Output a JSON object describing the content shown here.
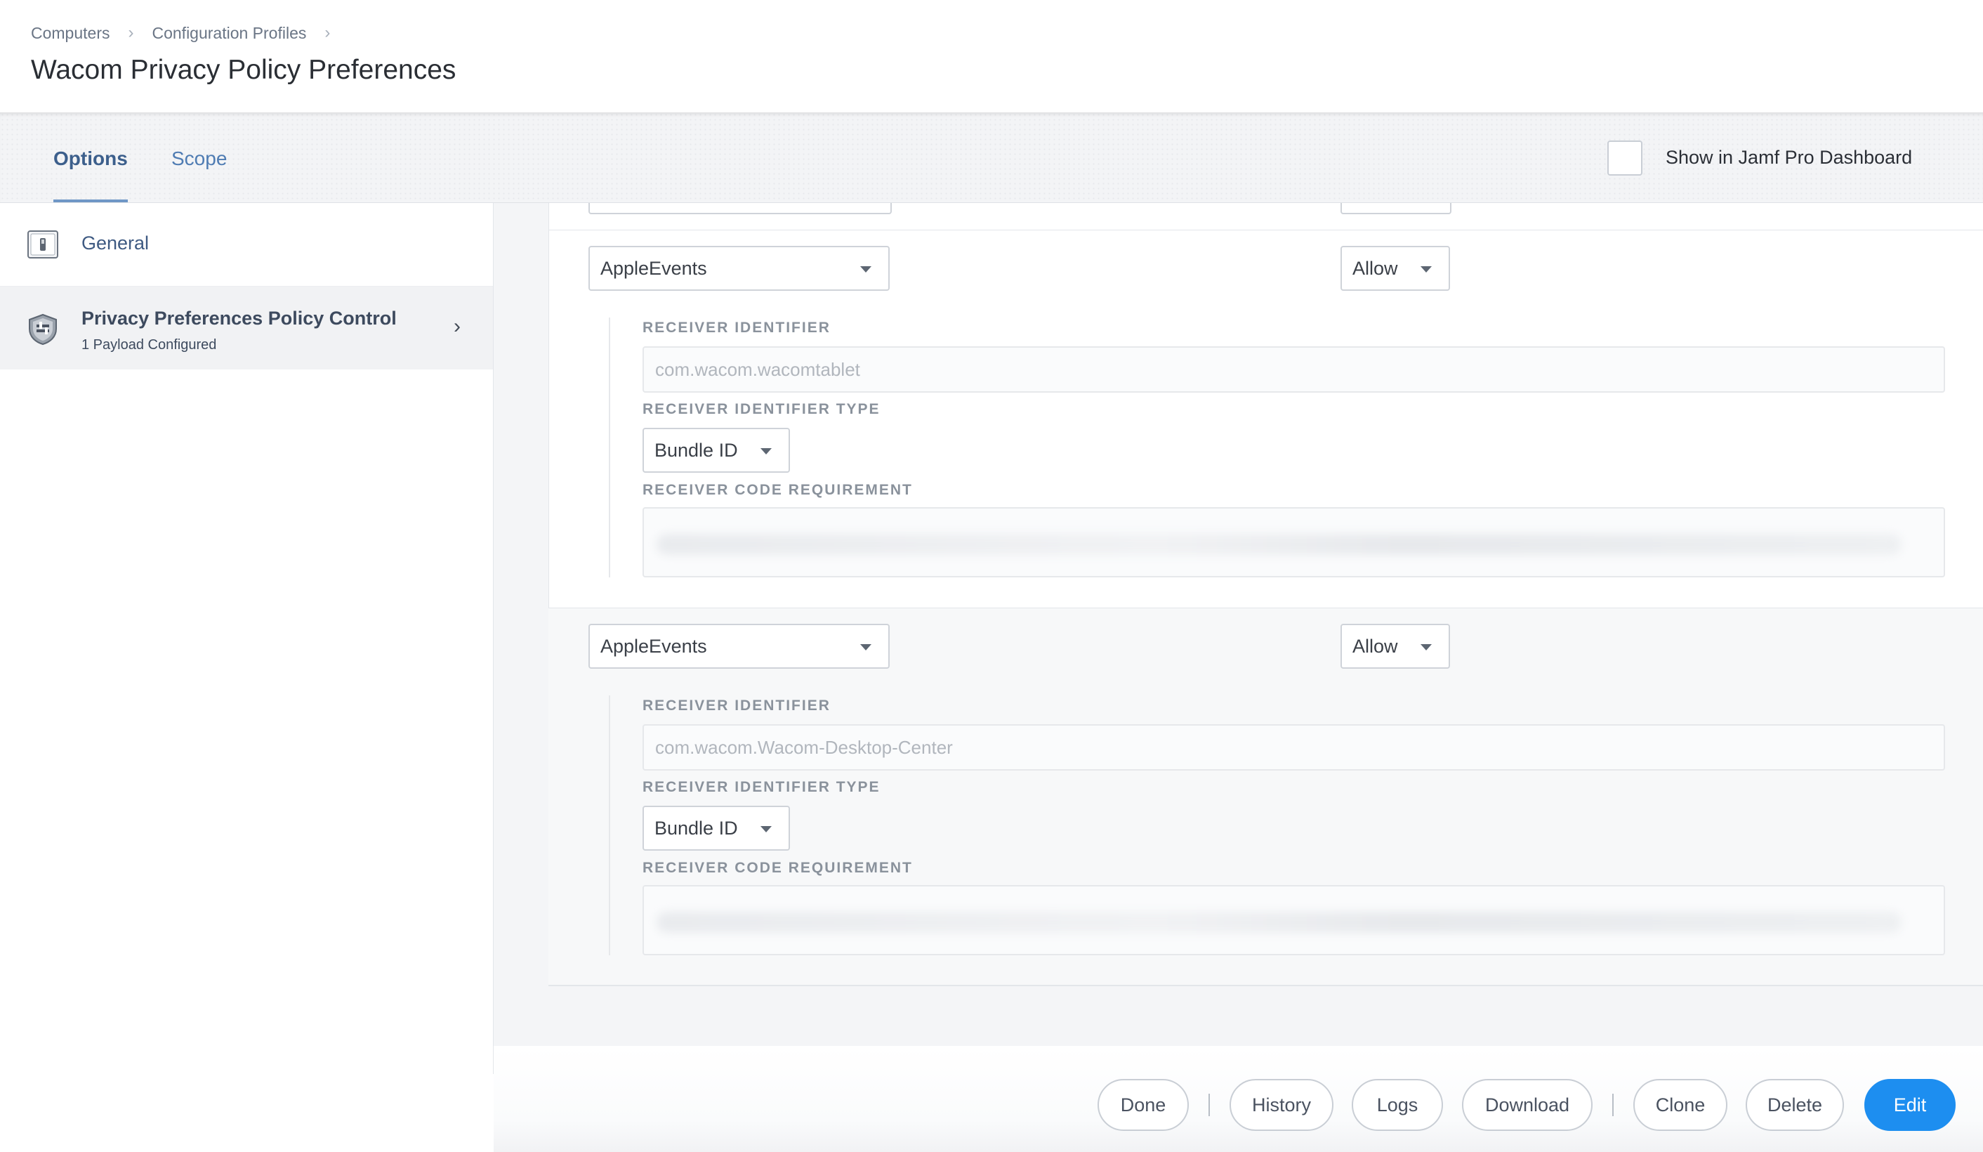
{
  "breadcrumb": {
    "items": [
      "Computers",
      "Configuration Profiles"
    ],
    "separator": "›"
  },
  "page": {
    "title": "Wacom Privacy Policy Preferences"
  },
  "tabs": [
    {
      "label": "Options",
      "active": true
    },
    {
      "label": "Scope",
      "active": false
    }
  ],
  "dashboard": {
    "label": "Show in Jamf Pro Dashboard",
    "checked": false
  },
  "sidebar": {
    "general": {
      "label": "General",
      "icon": "switch-icon"
    },
    "privacy": {
      "label": "Privacy Preferences Policy Control",
      "sub": "1 Payload Configured",
      "icon": "shield-icon"
    }
  },
  "entries": [
    {
      "service": "AppleEvents",
      "access": "Allow",
      "receiver_identifier_label": "RECEIVER IDENTIFIER",
      "receiver_identifier_value": "com.wacom.wacomtablet",
      "receiver_type_label": "RECEIVER IDENTIFIER TYPE",
      "receiver_type_value": "Bundle ID",
      "receiver_code_label": "RECEIVER CODE REQUIREMENT"
    },
    {
      "service": "AppleEvents",
      "access": "Allow",
      "receiver_identifier_label": "RECEIVER IDENTIFIER",
      "receiver_identifier_value": "com.wacom.Wacom-Desktop-Center",
      "receiver_type_label": "RECEIVER IDENTIFIER TYPE",
      "receiver_type_value": "Bundle ID",
      "receiver_code_label": "RECEIVER CODE REQUIREMENT"
    }
  ],
  "footer": {
    "done": "Done",
    "history": "History",
    "logs": "Logs",
    "download": "Download",
    "clone": "Clone",
    "delete": "Delete",
    "edit": "Edit"
  },
  "colors": {
    "accent": "#1d8ef0",
    "tab_active": "#3c5f8c",
    "link": "#4f7cb3"
  }
}
